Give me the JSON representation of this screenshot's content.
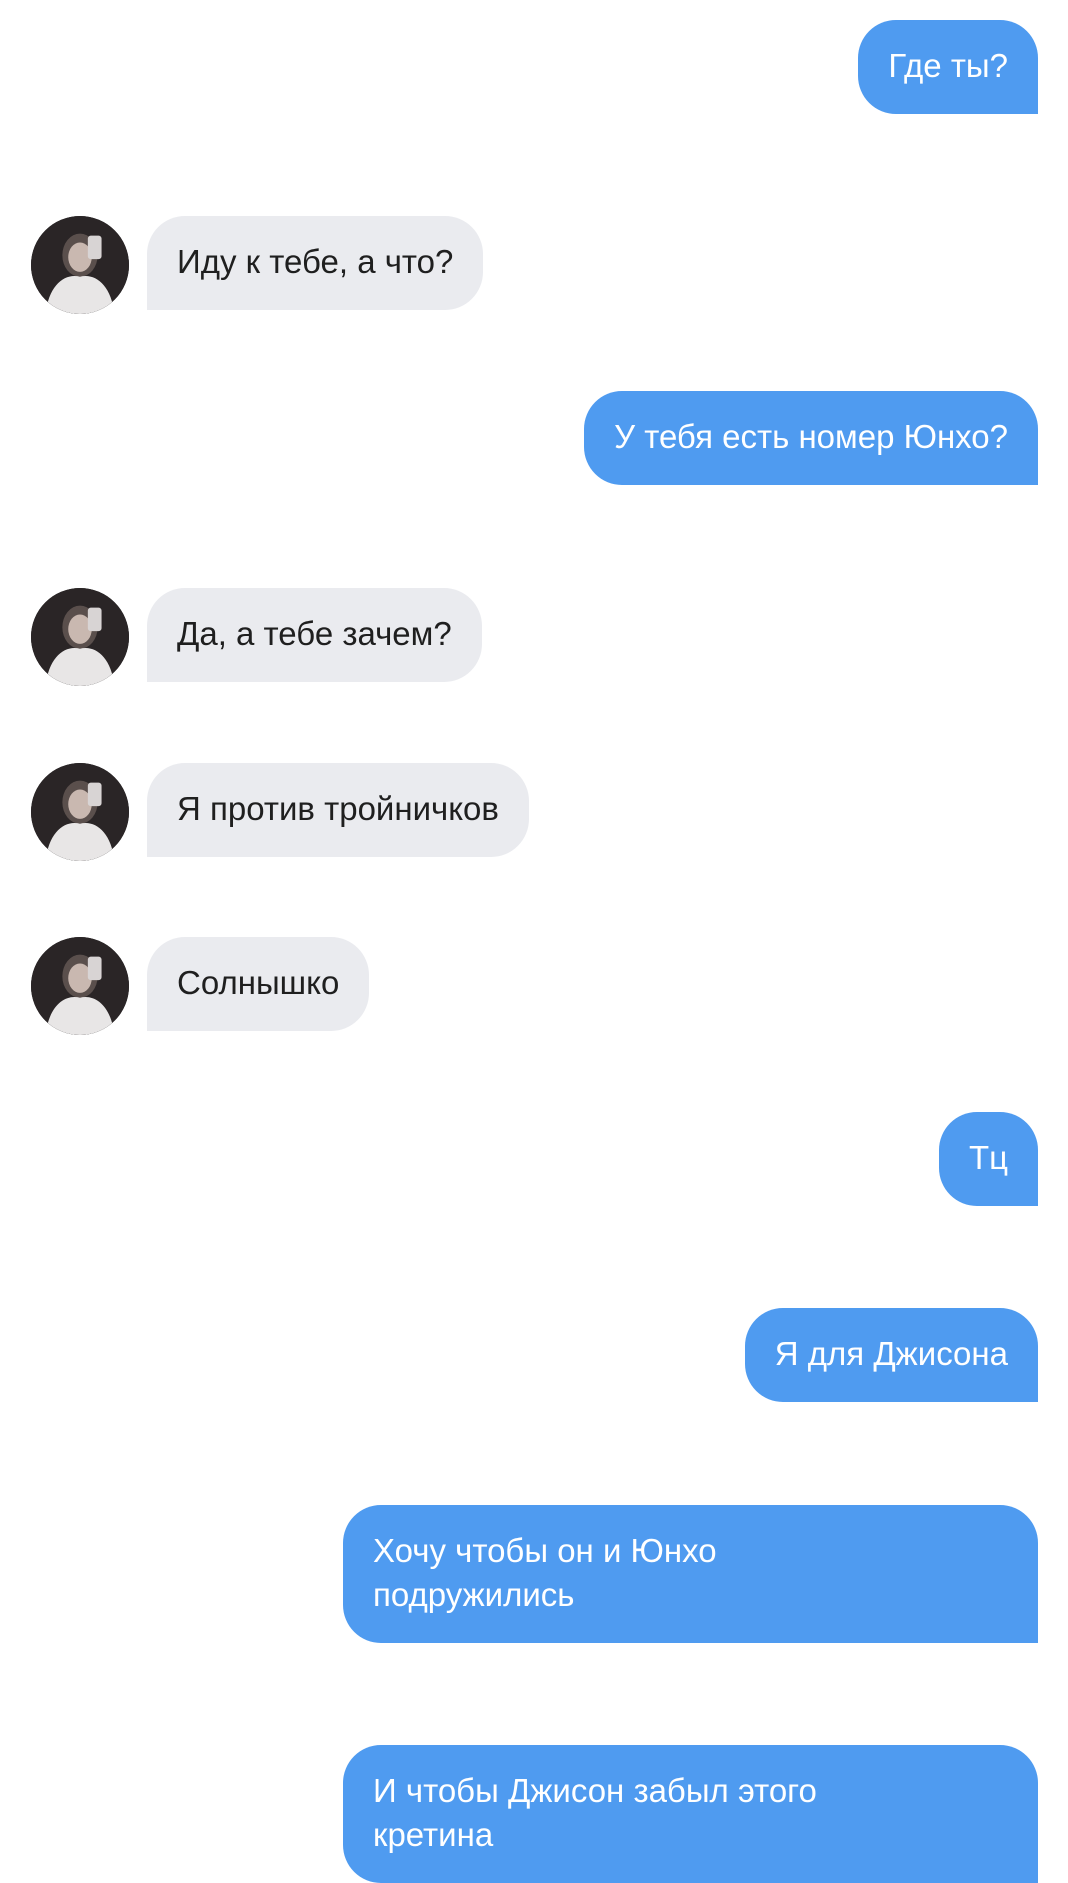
{
  "messages": [
    {
      "side": "out",
      "text": "Где ты?"
    },
    {
      "side": "in",
      "text": "Иду к тебе, а что?"
    },
    {
      "side": "out",
      "text": "У тебя есть номер Юнхо?"
    },
    {
      "side": "in",
      "text": "Да, а тебе зачем?"
    },
    {
      "side": "in",
      "text": "Я против тройничков"
    },
    {
      "side": "in",
      "text": "Солнышко"
    },
    {
      "side": "out",
      "text": "Тц"
    },
    {
      "side": "out",
      "text": "Я для Джисона"
    },
    {
      "side": "out",
      "text": "Хочу чтобы он и Юнхо\nподружились"
    },
    {
      "side": "out",
      "text": "И чтобы Джисон забыл этого\nкретина"
    }
  ],
  "colors": {
    "outgoing_bubble": "#4f9bf0",
    "incoming_bubble": "#eaebef",
    "background": "#ffffff"
  },
  "icons": {
    "avatar": "contact-avatar-photo"
  }
}
